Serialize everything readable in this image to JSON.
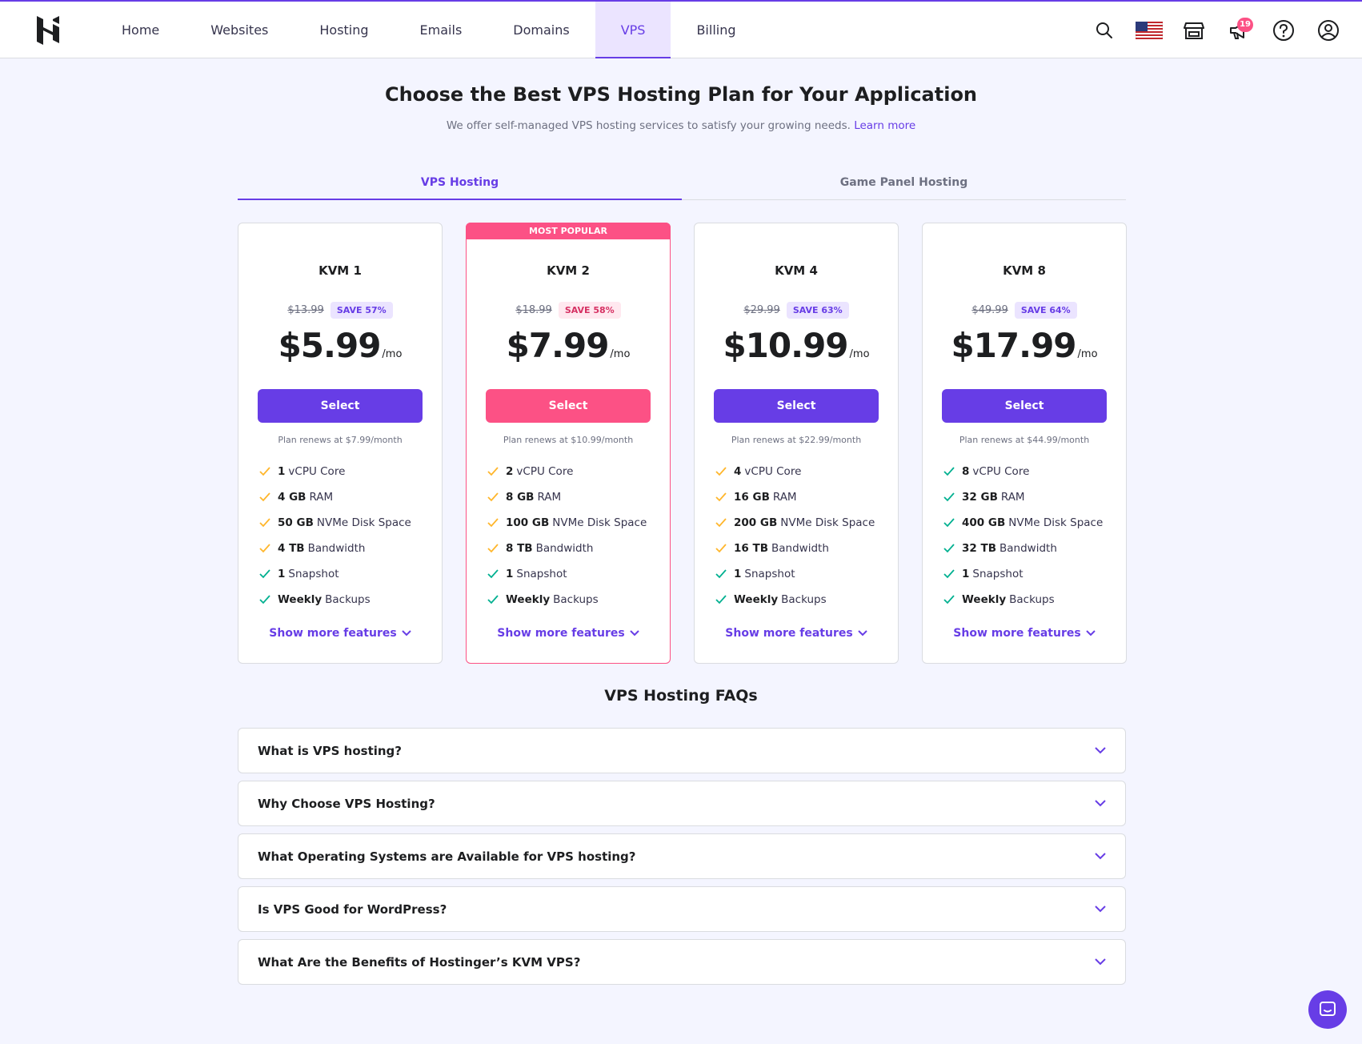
{
  "header": {
    "nav": [
      {
        "label": "Home"
      },
      {
        "label": "Websites"
      },
      {
        "label": "Hosting"
      },
      {
        "label": "Emails"
      },
      {
        "label": "Domains"
      },
      {
        "label": "VPS",
        "active": true
      },
      {
        "label": "Billing"
      }
    ],
    "notification_count": "19",
    "icons": [
      "search-icon",
      "us-flag-icon",
      "store-icon",
      "megaphone-icon",
      "help-icon",
      "account-icon"
    ]
  },
  "page": {
    "title": "Choose the Best VPS Hosting Plan for Your Application",
    "subtitle": "We offer self-managed VPS hosting services to satisfy your growing needs.",
    "learn_more": "Learn more"
  },
  "tabs": [
    {
      "label": "VPS Hosting",
      "active": true
    },
    {
      "label": "Game Panel Hosting",
      "active": false
    }
  ],
  "plans": [
    {
      "name": "KVM 1",
      "old_price": "$13.99",
      "save": "SAVE 57%",
      "price": "$5.99",
      "unit": "/mo",
      "button": "Select",
      "renews": "Plan renews at $7.99/month",
      "features": [
        {
          "bold": "1",
          "text": "vCPU Core"
        },
        {
          "bold": "4 GB",
          "text": "RAM"
        },
        {
          "bold": "50 GB",
          "text": "NVMe Disk Space"
        },
        {
          "bold": "4 TB",
          "text": "Bandwidth"
        },
        {
          "bold": "1",
          "text": "Snapshot"
        },
        {
          "bold": "Weekly",
          "text": "Backups"
        }
      ],
      "more": "Show more features"
    },
    {
      "name": "KVM 2",
      "banner": "MOST POPULAR",
      "old_price": "$18.99",
      "save": "SAVE 58%",
      "price": "$7.99",
      "unit": "/mo",
      "button": "Select",
      "renews": "Plan renews at $10.99/month",
      "features": [
        {
          "bold": "2",
          "text": "vCPU Core"
        },
        {
          "bold": "8 GB",
          "text": "RAM"
        },
        {
          "bold": "100 GB",
          "text": "NVMe Disk Space"
        },
        {
          "bold": "8 TB",
          "text": "Bandwidth"
        },
        {
          "bold": "1",
          "text": "Snapshot"
        },
        {
          "bold": "Weekly",
          "text": "Backups"
        }
      ],
      "more": "Show more features"
    },
    {
      "name": "KVM 4",
      "old_price": "$29.99",
      "save": "SAVE 63%",
      "price": "$10.99",
      "unit": "/mo",
      "button": "Select",
      "renews": "Plan renews at $22.99/month",
      "features": [
        {
          "bold": "4",
          "text": "vCPU Core"
        },
        {
          "bold": "16 GB",
          "text": "RAM"
        },
        {
          "bold": "200 GB",
          "text": "NVMe Disk Space"
        },
        {
          "bold": "16 TB",
          "text": "Bandwidth"
        },
        {
          "bold": "1",
          "text": "Snapshot"
        },
        {
          "bold": "Weekly",
          "text": "Backups"
        }
      ],
      "more": "Show more features"
    },
    {
      "name": "KVM 8",
      "old_price": "$49.99",
      "save": "SAVE 64%",
      "price": "$17.99",
      "unit": "/mo",
      "button": "Select",
      "renews": "Plan renews at $44.99/month",
      "features": [
        {
          "bold": "8",
          "text": "vCPU Core"
        },
        {
          "bold": "32 GB",
          "text": "RAM"
        },
        {
          "bold": "400 GB",
          "text": "NVMe Disk Space"
        },
        {
          "bold": "32 TB",
          "text": "Bandwidth"
        },
        {
          "bold": "1",
          "text": "Snapshot"
        },
        {
          "bold": "Weekly",
          "text": "Backups"
        }
      ],
      "more": "Show more features"
    }
  ],
  "faq": {
    "title": "VPS Hosting FAQs",
    "items": [
      {
        "q": "What is VPS hosting?"
      },
      {
        "q": "Why Choose VPS Hosting?"
      },
      {
        "q": "What Operating Systems are Available for VPS hosting?"
      },
      {
        "q": "Is VPS Good for WordPress?"
      },
      {
        "q": "What Are the Benefits of Hostinger’s KVM VPS?"
      }
    ]
  },
  "colors": {
    "primary": "#673de6",
    "popular": "#fc5185",
    "check_yellow": "#ffb62b",
    "check_green": "#00b090"
  }
}
